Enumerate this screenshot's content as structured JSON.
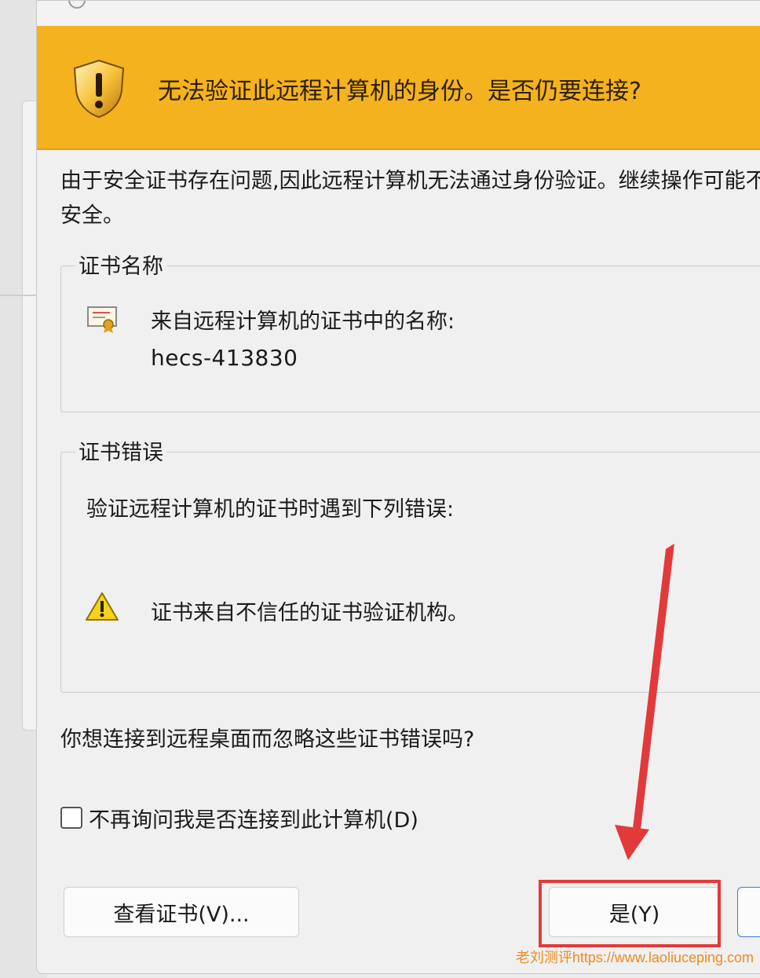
{
  "colors": {
    "banner": "#f5b21f",
    "highlight": "#e23a3a",
    "watermark": "#f08a1d"
  },
  "banner": {
    "icon": "shield-warning-icon",
    "title": "无法验证此远程计算机的身份。是否仍要连接?"
  },
  "description": "由于安全证书存在问题,因此远程计算机无法通过身份验证。继续操作可能不安全。",
  "cert_group": {
    "legend": "证书名称",
    "icon": "certificate-icon",
    "label": "来自远程计算机的证书中的名称:",
    "name": "hecs-413830"
  },
  "error_group": {
    "legend": "证书错误",
    "intro": "验证远程计算机的证书时遇到下列错误:",
    "icon": "warning-icon",
    "error": "证书来自不信任的证书验证机构。"
  },
  "question": "你想连接到远程桌面而忽略这些证书错误吗?",
  "checkbox": {
    "label": "不再询问我是否连接到此计算机(D)",
    "checked": false
  },
  "buttons": {
    "view_cert": "查看证书(V)...",
    "yes": "是(Y)",
    "no": ""
  },
  "watermark": "老刘测评https://www.laoliuceping.com"
}
